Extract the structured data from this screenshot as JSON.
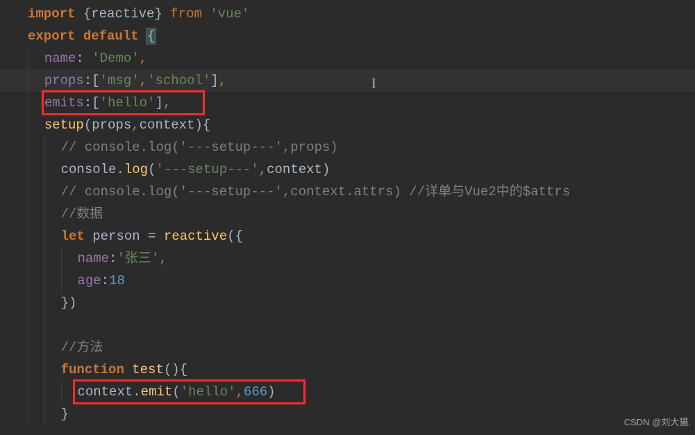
{
  "code": {
    "l01": {
      "import": "import",
      "lbrace": "{",
      "reactive": "reactive",
      "rbrace": "}",
      "from": "from",
      "vue": "'vue'"
    },
    "l02": {
      "export": "export",
      "default": "default",
      "lbrace": "{"
    },
    "l03": {
      "key": "name",
      "colon": ":",
      "val": "'Demo'",
      "comma": ","
    },
    "l04": {
      "key": "props",
      "colon": ":",
      "lb": "[",
      "msg": "'msg'",
      "comma1": ",",
      "school": "'school'",
      "rb": "]",
      "comma2": ","
    },
    "l05": {
      "key": "emits",
      "colon": ":",
      "lb": "[",
      "hello": "'hello'",
      "rb": "]",
      "comma": ","
    },
    "l06": {
      "fn": "setup",
      "lp": "(",
      "props": "props",
      "comma": ",",
      "context": "context",
      "rp": ")",
      "lbrace": "{"
    },
    "l07": {
      "comment": "// console.log('---setup---',props)"
    },
    "l08": {
      "console": "console",
      "dot": ".",
      "log": "log",
      "lp": "(",
      "str": "'---setup---'",
      "comma": ",",
      "context": "context",
      "rp": ")"
    },
    "l09": {
      "comment": "// console.log('---setup---',context.attrs) //详单与Vue2中的$attrs"
    },
    "l10": {
      "comment": "//数据"
    },
    "l11": {
      "let": "let",
      "person": "person",
      "eq": "=",
      "reactive": "reactive",
      "lp": "(",
      "lbrace": "{"
    },
    "l12": {
      "key": "name",
      "colon": ":",
      "val": "'张三'",
      "comma": ","
    },
    "l13": {
      "key": "age",
      "colon": ":",
      "val": "18"
    },
    "l14": {
      "rbrace": "}",
      "rp": ")"
    },
    "l15": {
      "blank": ""
    },
    "l16": {
      "comment": "//方法"
    },
    "l17": {
      "function": "function",
      "fn": "test",
      "lp": "(",
      "rp": ")",
      "lbrace": "{"
    },
    "l18": {
      "context": "context",
      "dot": ".",
      "emit": "emit",
      "lp": "(",
      "hello": "'hello'",
      "comma": ",",
      "num": "666",
      "rp": ")"
    },
    "l19": {
      "rbrace": "}"
    }
  },
  "watermark": "CSDN @刘大猫."
}
